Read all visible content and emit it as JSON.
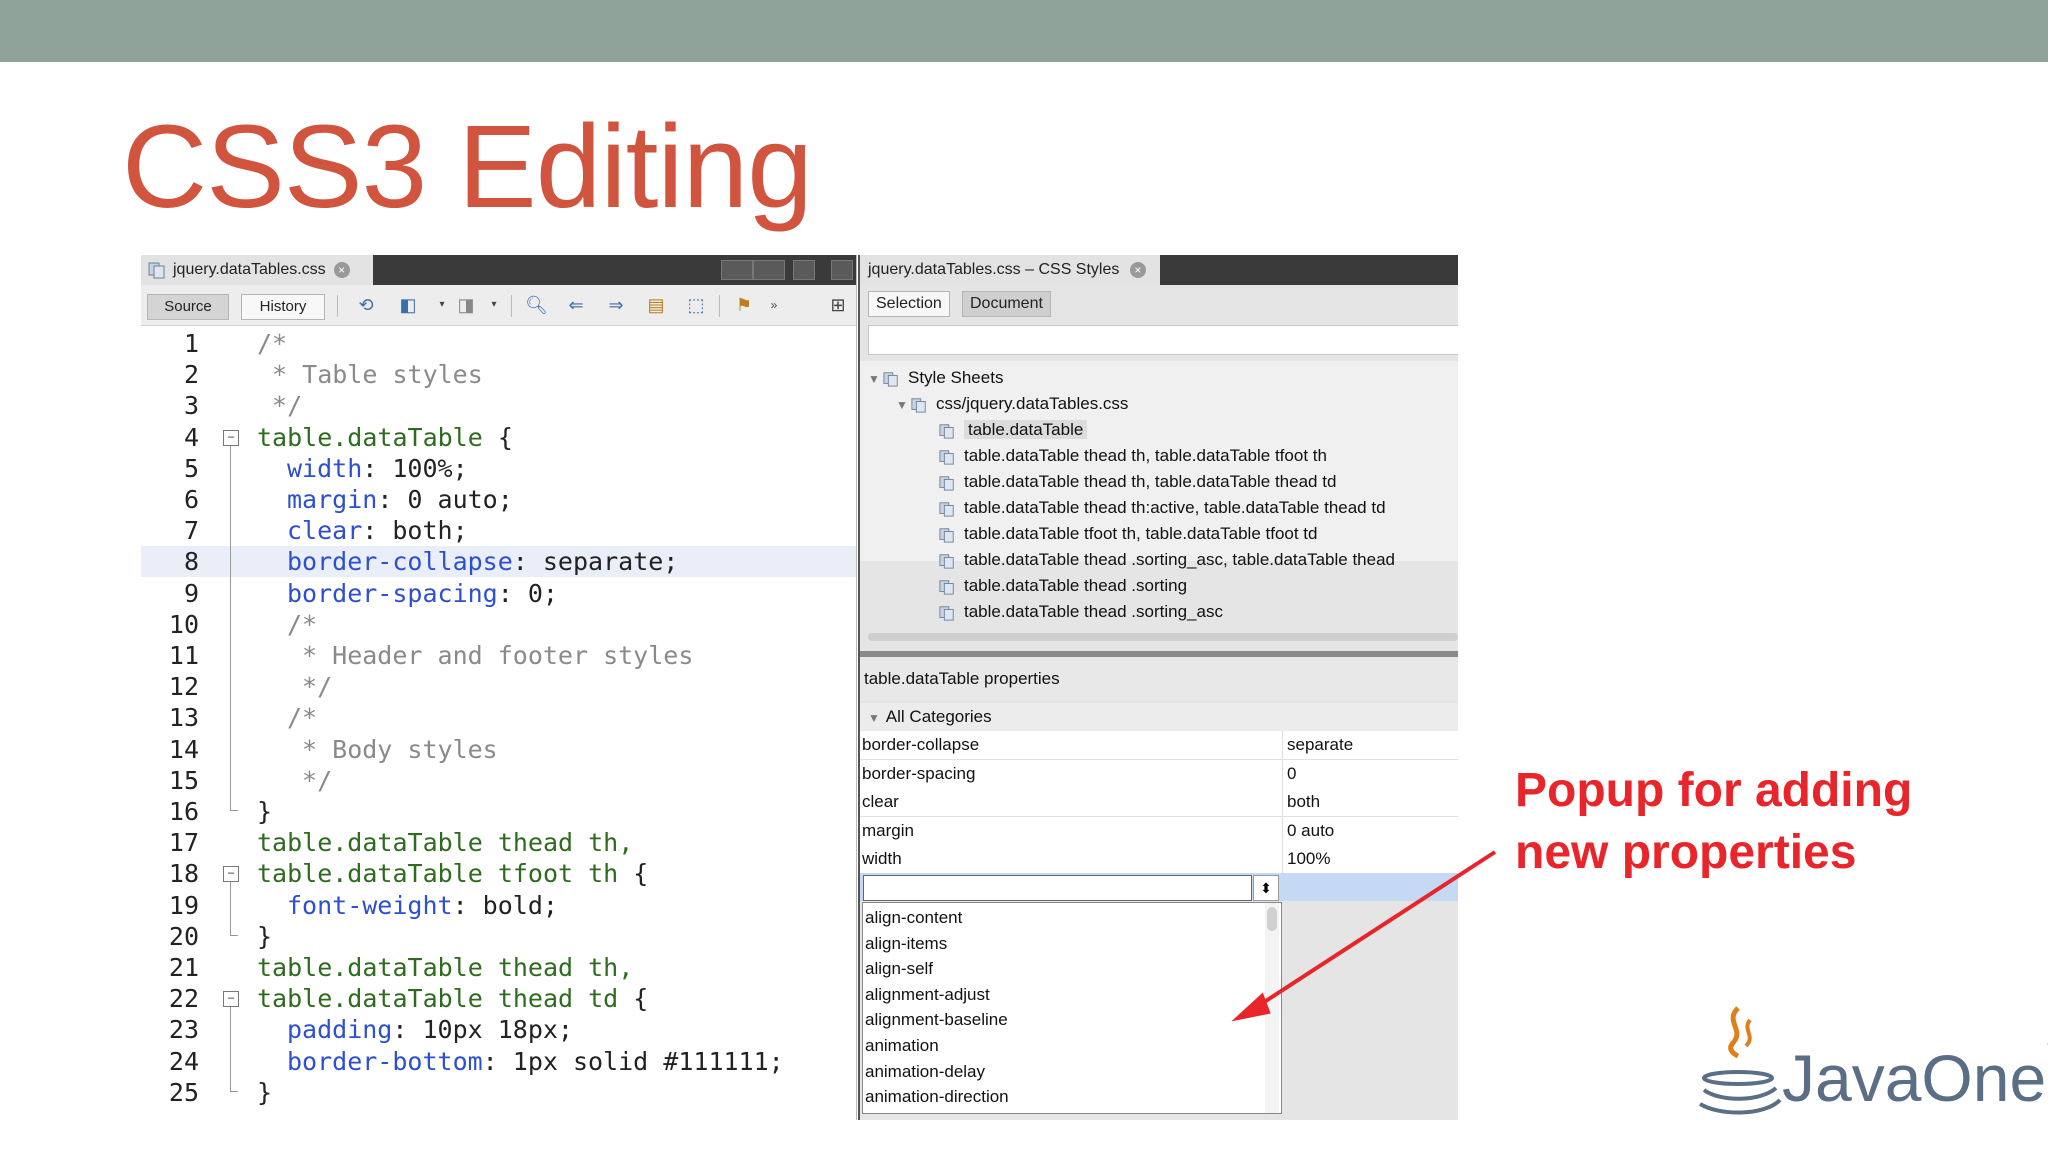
{
  "slide": {
    "title": "CSS3 Editing",
    "callout_line1": "Popup for adding",
    "callout_line2": "new properties",
    "logo_text": "JavaOne",
    "logo_tm": "™"
  },
  "editor": {
    "tab_label": "jquery.dataTables.css",
    "source_label": "Source",
    "history_label": "History",
    "lines": [
      {
        "n": "1",
        "segs": [
          [
            "cm",
            "/*"
          ]
        ],
        "indent": 0
      },
      {
        "n": "2",
        "segs": [
          [
            "cm",
            " * Table styles"
          ]
        ],
        "indent": 0
      },
      {
        "n": "3",
        "segs": [
          [
            "cm",
            " */"
          ]
        ],
        "indent": 0
      },
      {
        "n": "4",
        "segs": [
          [
            "sel",
            "table.dataTable"
          ],
          [
            "val",
            " {"
          ]
        ],
        "indent": 0
      },
      {
        "n": "5",
        "segs": [
          [
            "prop",
            "width"
          ],
          [
            "val",
            ": 100%;"
          ]
        ],
        "indent": 1
      },
      {
        "n": "6",
        "segs": [
          [
            "prop",
            "margin"
          ],
          [
            "val",
            ": 0 auto;"
          ]
        ],
        "indent": 1
      },
      {
        "n": "7",
        "segs": [
          [
            "prop",
            "clear"
          ],
          [
            "val",
            ": both;"
          ]
        ],
        "indent": 1
      },
      {
        "n": "8",
        "segs": [
          [
            "prop",
            "border-collapse"
          ],
          [
            "val",
            ": separate;"
          ]
        ],
        "indent": 1,
        "hl": true
      },
      {
        "n": "9",
        "segs": [
          [
            "prop",
            "border-spacing"
          ],
          [
            "val",
            ": 0;"
          ]
        ],
        "indent": 1
      },
      {
        "n": "10",
        "segs": [
          [
            "cm",
            "/*"
          ]
        ],
        "indent": 1
      },
      {
        "n": "11",
        "segs": [
          [
            "cm",
            " * Header and footer styles"
          ]
        ],
        "indent": 1
      },
      {
        "n": "12",
        "segs": [
          [
            "cm",
            " */"
          ]
        ],
        "indent": 1
      },
      {
        "n": "13",
        "segs": [
          [
            "cm",
            "/*"
          ]
        ],
        "indent": 1
      },
      {
        "n": "14",
        "segs": [
          [
            "cm",
            " * Body styles"
          ]
        ],
        "indent": 1
      },
      {
        "n": "15",
        "segs": [
          [
            "cm",
            " */"
          ]
        ],
        "indent": 1
      },
      {
        "n": "16",
        "segs": [
          [
            "val",
            "}"
          ]
        ],
        "indent": 0
      },
      {
        "n": "17",
        "segs": [
          [
            "sel",
            "table.dataTable thead th,"
          ]
        ],
        "indent": 0
      },
      {
        "n": "18",
        "segs": [
          [
            "sel",
            "table.dataTable tfoot th"
          ],
          [
            "val",
            " {"
          ]
        ],
        "indent": 0
      },
      {
        "n": "19",
        "segs": [
          [
            "prop",
            "font-weight"
          ],
          [
            "val",
            ": bold;"
          ]
        ],
        "indent": 1
      },
      {
        "n": "20",
        "segs": [
          [
            "val",
            "}"
          ]
        ],
        "indent": 0
      },
      {
        "n": "21",
        "segs": [
          [
            "sel",
            "table.dataTable thead th,"
          ]
        ],
        "indent": 0
      },
      {
        "n": "22",
        "segs": [
          [
            "sel",
            "table.dataTable thead td"
          ],
          [
            "val",
            " {"
          ]
        ],
        "indent": 0
      },
      {
        "n": "23",
        "segs": [
          [
            "prop",
            "padding"
          ],
          [
            "val",
            ": 10px 18px;"
          ]
        ],
        "indent": 1
      },
      {
        "n": "24",
        "segs": [
          [
            "prop",
            "border-bottom"
          ],
          [
            "val",
            ": 1px solid #111111;"
          ]
        ],
        "indent": 1
      },
      {
        "n": "25",
        "segs": [
          [
            "val",
            "}"
          ]
        ],
        "indent": 0
      }
    ]
  },
  "styles": {
    "tab_label": "jquery.dataTables.css – CSS Styles",
    "selection_label": "Selection",
    "document_label": "Document",
    "tree": [
      {
        "label": "Style Sheets",
        "level": 0,
        "expanded": true
      },
      {
        "label": "css/jquery.dataTables.css",
        "level": 1,
        "expanded": true
      },
      {
        "label": "table.dataTable",
        "level": 2,
        "selected": true
      },
      {
        "label": "table.dataTable thead th, table.dataTable tfoot th",
        "level": 2
      },
      {
        "label": "table.dataTable thead th, table.dataTable thead td",
        "level": 2
      },
      {
        "label": "table.dataTable thead th:active, table.dataTable thead td",
        "level": 2
      },
      {
        "label": "table.dataTable tfoot th, table.dataTable tfoot td",
        "level": 2
      },
      {
        "label": "table.dataTable thead .sorting_asc, table.dataTable thead",
        "level": 2
      },
      {
        "label": "table.dataTable thead .sorting",
        "level": 2
      },
      {
        "label": "table.dataTable thead .sorting_asc",
        "level": 2
      }
    ],
    "properties_header": "table.dataTable properties",
    "category": "All Categories",
    "properties": [
      {
        "name": "border-collapse",
        "value": "separate"
      },
      {
        "name": "border-spacing",
        "value": "0"
      },
      {
        "name": "clear",
        "value": "both"
      },
      {
        "name": "margin",
        "value": "0 auto"
      },
      {
        "name": "width",
        "value": "100%"
      }
    ],
    "new_property_value": "",
    "dropdown": [
      "align-content",
      "align-items",
      "align-self",
      "alignment-adjust",
      "alignment-baseline",
      "animation",
      "animation-delay",
      "animation-direction"
    ]
  },
  "colors": {
    "title": "#d0543e",
    "callout": "#e8252a",
    "topbar": "#8fa39a",
    "selector": "#2e6b1f",
    "property": "#2d4fd0",
    "comment": "#8a8a8a"
  }
}
